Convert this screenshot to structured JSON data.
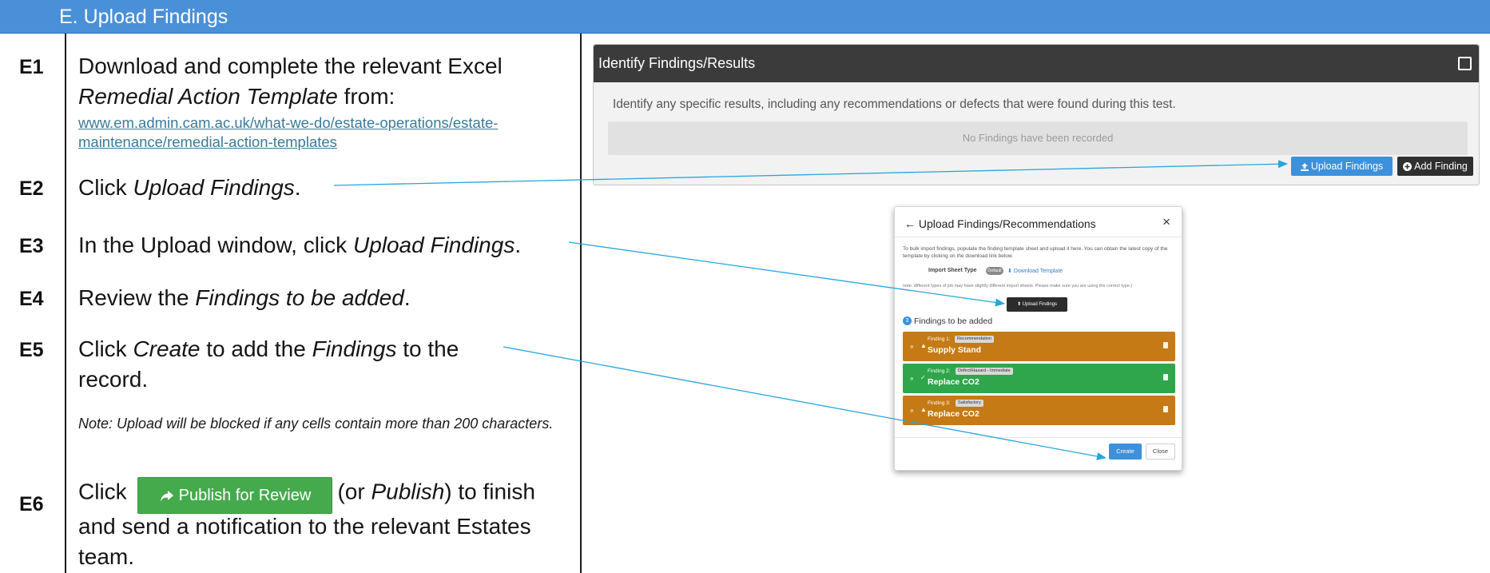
{
  "header": {
    "title": "E.  Upload Findings"
  },
  "steps": [
    {
      "id": "E1",
      "text_before": "Download and complete the relevant Excel",
      "text_italic": "Remedial Action Template",
      "text_after": " from:",
      "link": "www.em.admin.cam.ac.uk/what-we-do/estate-operations/estate-maintenance/remedial-action-templates"
    },
    {
      "id": "E2",
      "text_before": "Click ",
      "text_italic": "Upload Findings",
      "text_after": "."
    },
    {
      "id": "E3",
      "text_before": "In the Upload window, click ",
      "text_italic": "Upload Findings",
      "text_after": "."
    },
    {
      "id": "E4",
      "text_before": "Review the ",
      "text_italic": "Findings to be added",
      "text_after": "."
    },
    {
      "id": "E5",
      "text_before": "Click ",
      "text_italic": "Create",
      "text_middle": " to add the ",
      "text_italic2": "Findings",
      "text_after": " to the record.",
      "note": "Note: Upload will be blocked if any cells contain more than 200 characters."
    },
    {
      "id": "E6",
      "text_before": "Click",
      "button_label": "Publish for Review",
      "text_mid": "(or ",
      "text_italic": "Publish",
      "text_after": ") to finish and send a notification to the relevant Estates team."
    }
  ],
  "findings_panel": {
    "title": "Identify Findings/Results",
    "description": "Identify any specific results, including any recommendations or defects that were found during this test.",
    "empty_message": "No Findings have been recorded",
    "upload_button": "Upload Findings",
    "add_button": "Add Finding"
  },
  "upload_modal": {
    "title": "← Upload Findings/Recommendations",
    "close": "×",
    "intro": "To bulk import findings, populate the finding template sheet and upload it here. You can obtain the latest copy of the template by clicking on the download link below.",
    "import_sheet_type_label": "Import Sheet Type",
    "import_sheet_type_value": "Default",
    "download_template": "Download Template",
    "note": "note: different types of job may have slightly different import sheets. Please make sure you are using the correct type.)",
    "upload_button": "Upload Findings",
    "count": "3",
    "count_label": "Findings to be added",
    "findings": [
      {
        "label": "Finding 1:",
        "tag": "Recommendation",
        "name": "Supply Stand",
        "color": "#c57a15"
      },
      {
        "label": "Finding 2:",
        "tag": "Defect/Hazard - Immediate",
        "name": "Replace CO2",
        "color": "#2fa64b"
      },
      {
        "label": "Finding 3:",
        "tag": "Satisfactory",
        "name": "Replace CO2",
        "color": "#c57a15"
      }
    ],
    "create_button": "Create",
    "close_button": "Close"
  }
}
